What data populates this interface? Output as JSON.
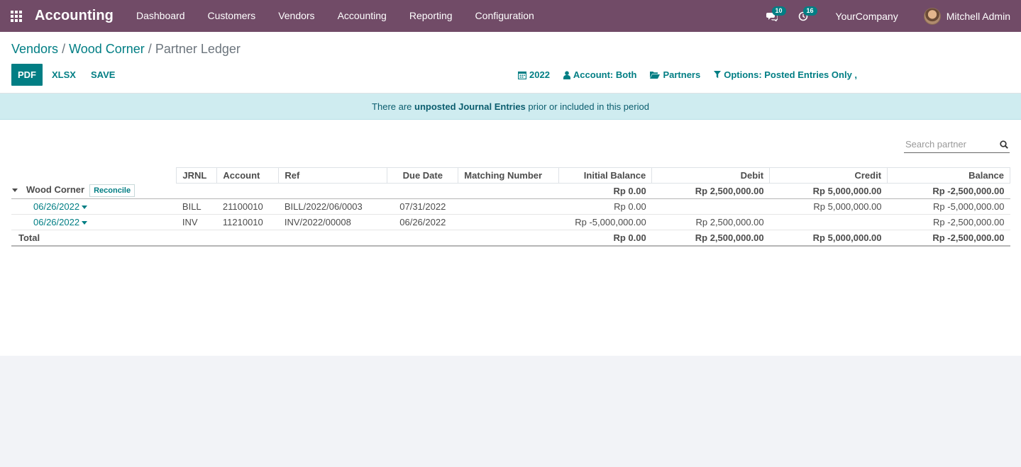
{
  "navbar": {
    "app_name": "Accounting",
    "menu": [
      "Dashboard",
      "Customers",
      "Vendors",
      "Accounting",
      "Reporting",
      "Configuration"
    ],
    "messages_badge": "10",
    "activities_badge": "16",
    "company": "YourCompany",
    "user": "Mitchell Admin",
    "bg_color": "#714b67"
  },
  "breadcrumb": {
    "vendors": "Vendors",
    "partner": "Wood Corner",
    "current": "Partner Ledger",
    "sep": "/"
  },
  "toolbar": {
    "pdf": "PDF",
    "xlsx": "XLSX",
    "save": "SAVE"
  },
  "filters": {
    "date": "2022",
    "account": "Account: Both",
    "partners": "Partners",
    "options": "Options: Posted Entries Only ,"
  },
  "alert": {
    "before": "There are ",
    "bold": "unposted Journal Entries",
    "after": " prior or included in this period"
  },
  "search": {
    "placeholder": "Search partner"
  },
  "table": {
    "headers": {
      "jrnl": "JRNL",
      "account": "Account",
      "ref": "Ref",
      "due_date": "Due Date",
      "matching": "Matching Number",
      "initial_balance": "Initial Balance",
      "debit": "Debit",
      "credit": "Credit",
      "balance": "Balance"
    },
    "partner": {
      "name": "Wood Corner",
      "reconcile": "Reconcile",
      "initial_balance": "Rp 0.00",
      "debit": "Rp 2,500,000.00",
      "credit": "Rp 5,000,000.00",
      "balance": "Rp -2,500,000.00"
    },
    "lines": [
      {
        "date": "06/26/2022",
        "jrnl": "BILL",
        "account": "21100010",
        "ref": "BILL/2022/06/0003",
        "due_date": "07/31/2022",
        "matching": "",
        "initial_balance": "Rp 0.00",
        "debit": "",
        "credit": "Rp 5,000,000.00",
        "balance": "Rp -5,000,000.00"
      },
      {
        "date": "06/26/2022",
        "jrnl": "INV",
        "account": "11210010",
        "ref": "INV/2022/00008",
        "due_date": "06/26/2022",
        "matching": "",
        "initial_balance": "Rp -5,000,000.00",
        "debit": "Rp 2,500,000.00",
        "credit": "",
        "balance": "Rp -2,500,000.00"
      }
    ],
    "total": {
      "label": "Total",
      "initial_balance": "Rp 0.00",
      "debit": "Rp 2,500,000.00",
      "credit": "Rp 5,000,000.00",
      "balance": "Rp -2,500,000.00"
    }
  }
}
